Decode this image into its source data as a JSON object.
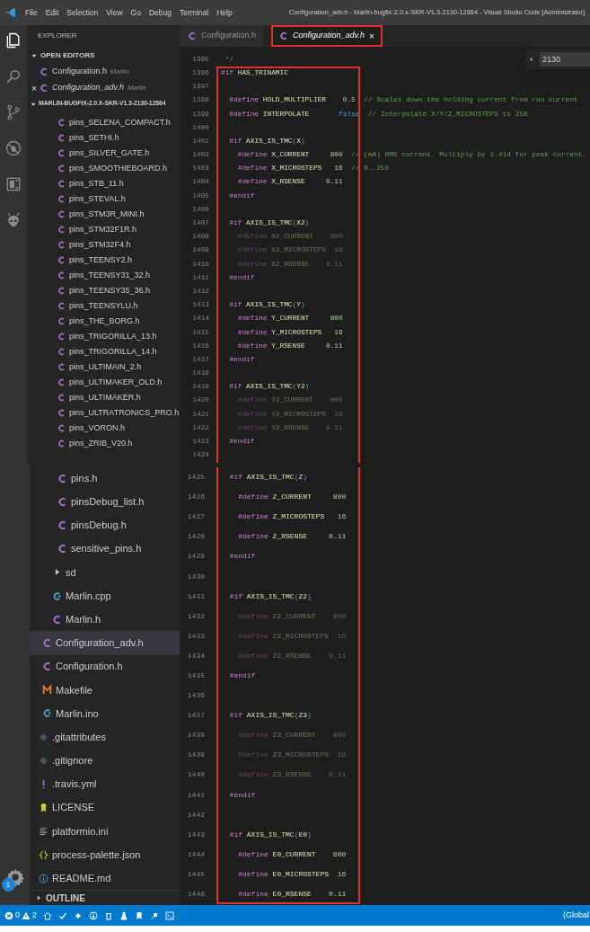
{
  "title_bar": {
    "menu": [
      "File",
      "Edit",
      "Selection",
      "View",
      "Go",
      "Debug",
      "Terminal",
      "Help"
    ],
    "title": "Configuration_adv.h - Marlin-bugfix-2.0.x-SKR-V1.3-2130-12864 - Visual Studio Code [Administrator]"
  },
  "activity_bar": {
    "items": [
      {
        "kind": "files",
        "selected": true
      },
      {
        "kind": "search",
        "selected": false
      },
      {
        "kind": "scm",
        "selected": false
      },
      {
        "kind": "debug",
        "selected": false
      },
      {
        "kind": "extensions",
        "selected": false
      },
      {
        "kind": "alien",
        "selected": false
      }
    ],
    "settings_badge": "1"
  },
  "sidebar": {
    "header": "EXPLORER",
    "open_editors": {
      "label": "OPEN EDITORS",
      "expanded": true,
      "items": [
        {
          "name": "Configuration.h",
          "folder": "Marlin",
          "kind": "c",
          "preview": false
        },
        {
          "name": "Configuration_adv.h",
          "folder": "Marlin",
          "kind": "c",
          "preview": true,
          "close": "×"
        }
      ]
    },
    "project": {
      "label": "MARLIN-BUGFIX-2.0.X-SKR-V1.3-2130-12864",
      "expanded": true
    },
    "top_files": [
      {
        "name": "pins_SELENA_COMPACT.h",
        "kind": "c",
        "selected": false
      },
      {
        "name": "pins_SETHI.h",
        "kind": "c",
        "selected": false
      },
      {
        "name": "pins_SILVER_GATE.h",
        "kind": "c",
        "selected": false
      },
      {
        "name": "pins_SMOOTHIEBOARD.h",
        "kind": "c",
        "selected": false
      },
      {
        "name": "pins_STB_11.h",
        "kind": "c",
        "selected": false
      },
      {
        "name": "pins_STEVAL.h",
        "kind": "c",
        "selected": false
      },
      {
        "name": "pins_STM3R_MINI.h",
        "kind": "c",
        "selected": false
      },
      {
        "name": "pins_STM32F1R.h",
        "kind": "c",
        "selected": false
      },
      {
        "name": "pins_STM32F4.h",
        "kind": "c",
        "selected": false
      },
      {
        "name": "pins_TEENSY2.h",
        "kind": "c",
        "selected": false
      },
      {
        "name": "pins_TEENSY31_32.h",
        "kind": "c",
        "selected": false
      },
      {
        "name": "pins_TEENSY35_36.h",
        "kind": "c",
        "selected": false
      },
      {
        "name": "pins_TEENSYLU.h",
        "kind": "c",
        "selected": false
      },
      {
        "name": "pins_THE_BORG.h",
        "kind": "c",
        "selected": false
      },
      {
        "name": "pins_TRIGORILLA_13.h",
        "kind": "c",
        "selected": false
      },
      {
        "name": "pins_TRIGORILLA_14.h",
        "kind": "c",
        "selected": false
      },
      {
        "name": "pins_ULTIMAIN_2.h",
        "kind": "c",
        "selected": false
      },
      {
        "name": "pins_ULTIMAKER_OLD.h",
        "kind": "c",
        "selected": false
      },
      {
        "name": "pins_ULTIMAKER.h",
        "kind": "c",
        "selected": false
      },
      {
        "name": "pins_ULTRATRONICS_PRO.h",
        "kind": "c",
        "selected": false
      },
      {
        "name": "pins_VORON.h",
        "kind": "c",
        "selected": false
      },
      {
        "name": "pins_ZRIB_V20.h",
        "kind": "c",
        "selected": false
      }
    ],
    "bottom_files": {
      "pins_level": [
        {
          "name": "pins.h",
          "kind": "c",
          "selected": false
        },
        {
          "name": "pinsDebug_list.h",
          "kind": "c",
          "selected": false
        },
        {
          "name": "pinsDebug.h",
          "kind": "c",
          "selected": false
        },
        {
          "name": "sensitive_pins.h",
          "kind": "c",
          "selected": false
        }
      ],
      "src_level": [
        {
          "name": "sd",
          "kind": "folder",
          "expanded": false,
          "selected": false
        },
        {
          "name": "Marlin.cpp",
          "kind": "cpp",
          "selected": false
        },
        {
          "name": "Marlin.h",
          "kind": "c",
          "selected": false
        }
      ],
      "marlin_level": [
        {
          "name": "Configuration_adv.h",
          "kind": "c",
          "selected": true
        },
        {
          "name": "Configuration.h",
          "kind": "c",
          "selected": false
        },
        {
          "name": "Makefile",
          "kind": "make",
          "selected": false
        },
        {
          "name": "Marlin.ino",
          "kind": "ino",
          "selected": false
        }
      ],
      "root_level": [
        {
          "name": ".gitattributes",
          "kind": "git",
          "selected": false
        },
        {
          "name": ".gitignore",
          "kind": "git",
          "selected": false
        },
        {
          "name": ".travis.yml",
          "kind": "yaml",
          "selected": false
        },
        {
          "name": "LICENSE",
          "kind": "license",
          "selected": false
        },
        {
          "name": "platformio.ini",
          "kind": "ini",
          "selected": false
        },
        {
          "name": "process-palette.json",
          "kind": "json",
          "selected": false
        },
        {
          "name": "README.md",
          "kind": "readme",
          "selected": false
        }
      ]
    },
    "outline": {
      "label": "OUTLINE",
      "expanded": false
    }
  },
  "tabs": [
    {
      "label": "Configuration.h",
      "kind": "c",
      "selected": false,
      "preview": false,
      "highlighted": false
    },
    {
      "label": "Configuration_adv.h",
      "kind": "c",
      "selected": true,
      "preview": true,
      "highlighted": true,
      "close": "×"
    }
  ],
  "find_widget": {
    "value": "2130"
  },
  "editor_top": {
    "lines": [
      {
        "n": "1395",
        "inactive": false,
        "tokens": [
          {
            "kind": "comment",
            "text": " */"
          }
        ]
      }
    ],
    "frame": {
      "closed_top": true,
      "closed_bottom": false,
      "lines": [
        {
          "n": "1396",
          "inactive": false,
          "tokens": [
            {
              "kind": "keyword",
              "text": "#if"
            },
            {
              "kind": "name",
              "text": " HAS_TRINAMIC"
            }
          ]
        },
        {
          "n": "1397"
        },
        {
          "n": "1398",
          "inactive": false,
          "tokens": [
            {
              "kind": "keyword",
              "text": "  #define"
            },
            {
              "kind": "name",
              "text": " HOLD_MULTIPLIER"
            },
            {
              "kind": "number",
              "text": "    0.5"
            },
            {
              "kind": "comment",
              "text": "  // Scales down the holding current from run current"
            }
          ]
        },
        {
          "n": "1399",
          "inactive": false,
          "tokens": [
            {
              "kind": "keyword",
              "text": "  #define"
            },
            {
              "kind": "name",
              "text": " INTERPOLATE"
            },
            {
              "kind": "bool",
              "text": "       false"
            },
            {
              "kind": "comment",
              "text": "  // Interpolate X/Y/Z_MICROSTEPS to 256"
            }
          ]
        },
        {
          "n": "1400"
        },
        {
          "n": "1401",
          "inactive": false,
          "tokens": [
            {
              "kind": "keyword",
              "text": "  #if"
            },
            {
              "kind": "name",
              "text": " AXIS_IS_TMC"
            },
            {
              "kind": "paren",
              "text": "("
            },
            {
              "kind": "name",
              "text": "X"
            },
            {
              "kind": "paren",
              "text": ")"
            }
          ]
        },
        {
          "n": "1402",
          "inactive": false,
          "tokens": [
            {
              "kind": "keyword",
              "text": "    #define"
            },
            {
              "kind": "name",
              "text": " X_CURRENT"
            },
            {
              "kind": "number",
              "text": "     800"
            },
            {
              "kind": "comment",
              "text": "  // (mA) RMS current. Multiply by 1.414 for peak current."
            }
          ]
        },
        {
          "n": "1403",
          "inactive": false,
          "tokens": [
            {
              "kind": "keyword",
              "text": "    #define"
            },
            {
              "kind": "name",
              "text": " X_MICROSTEPS"
            },
            {
              "kind": "number",
              "text": "   16"
            },
            {
              "kind": "comment",
              "text": "  // 0..256"
            }
          ]
        },
        {
          "n": "1404",
          "inactive": false,
          "tokens": [
            {
              "kind": "keyword",
              "text": "    #define"
            },
            {
              "kind": "name",
              "text": " X_RSENSE"
            },
            {
              "kind": "number",
              "text": "     0.11"
            }
          ]
        },
        {
          "n": "1405",
          "inactive": false,
          "tokens": [
            {
              "kind": "keyword",
              "text": "  #endif"
            }
          ]
        },
        {
          "n": "1406"
        },
        {
          "n": "1407",
          "inactive": false,
          "tokens": [
            {
              "kind": "keyword",
              "text": "  #if"
            },
            {
              "kind": "name",
              "text": " AXIS_IS_TMC"
            },
            {
              "kind": "paren",
              "text": "("
            },
            {
              "kind": "name",
              "text": "X2"
            },
            {
              "kind": "paren",
              "text": ")"
            }
          ]
        },
        {
          "n": "1408",
          "inactive": true,
          "tokens": [
            {
              "kind": "keyword",
              "text": "    #define"
            },
            {
              "kind": "name",
              "text": " X2_CURRENT"
            },
            {
              "kind": "number",
              "text": "    800"
            }
          ]
        },
        {
          "n": "1409",
          "inactive": true,
          "tokens": [
            {
              "kind": "keyword",
              "text": "    #define"
            },
            {
              "kind": "name",
              "text": " X2_MICROSTEPS"
            },
            {
              "kind": "number",
              "text": "  16"
            }
          ]
        },
        {
          "n": "1410",
          "inactive": true,
          "tokens": [
            {
              "kind": "keyword",
              "text": "    #define"
            },
            {
              "kind": "name",
              "text": " X2_RSENSE"
            },
            {
              "kind": "number",
              "text": "    0.11"
            }
          ]
        },
        {
          "n": "1411",
          "inactive": false,
          "tokens": [
            {
              "kind": "keyword",
              "text": "  #endif"
            }
          ]
        },
        {
          "n": "1412"
        },
        {
          "n": "1413",
          "inactive": false,
          "tokens": [
            {
              "kind": "keyword",
              "text": "  #if"
            },
            {
              "kind": "name",
              "text": " AXIS_IS_TMC"
            },
            {
              "kind": "paren",
              "text": "("
            },
            {
              "kind": "name",
              "text": "Y"
            },
            {
              "kind": "paren",
              "text": ")"
            }
          ]
        },
        {
          "n": "1414",
          "inactive": false,
          "tokens": [
            {
              "kind": "keyword",
              "text": "    #define"
            },
            {
              "kind": "name",
              "text": " Y_CURRENT"
            },
            {
              "kind": "number",
              "text": "     800"
            }
          ]
        },
        {
          "n": "1415",
          "inactive": false,
          "tokens": [
            {
              "kind": "keyword",
              "text": "    #define"
            },
            {
              "kind": "name",
              "text": " Y_MICROSTEPS"
            },
            {
              "kind": "number",
              "text": "   16"
            }
          ]
        },
        {
          "n": "1416",
          "inactive": false,
          "tokens": [
            {
              "kind": "keyword",
              "text": "    #define"
            },
            {
              "kind": "name",
              "text": " Y_RSENSE"
            },
            {
              "kind": "number",
              "text": "     0.11"
            }
          ]
        },
        {
          "n": "1417",
          "inactive": false,
          "tokens": [
            {
              "kind": "keyword",
              "text": "  #endif"
            }
          ]
        },
        {
          "n": "1418"
        },
        {
          "n": "1419",
          "inactive": false,
          "tokens": [
            {
              "kind": "keyword",
              "text": "  #if"
            },
            {
              "kind": "name",
              "text": " AXIS_IS_TMC"
            },
            {
              "kind": "paren",
              "text": "("
            },
            {
              "kind": "name",
              "text": "Y2"
            },
            {
              "kind": "paren",
              "text": ")"
            }
          ]
        },
        {
          "n": "1420",
          "inactive": true,
          "tokens": [
            {
              "kind": "keyword",
              "text": "    #define"
            },
            {
              "kind": "name",
              "text": " Y2_CURRENT"
            },
            {
              "kind": "number",
              "text": "    800"
            }
          ]
        },
        {
          "n": "1421",
          "inactive": true,
          "tokens": [
            {
              "kind": "keyword",
              "text": "    #define"
            },
            {
              "kind": "name",
              "text": " Y2_MICROSTEPS"
            },
            {
              "kind": "number",
              "text": "  16"
            }
          ]
        },
        {
          "n": "1422",
          "inactive": true,
          "tokens": [
            {
              "kind": "keyword",
              "text": "    #define"
            },
            {
              "kind": "name",
              "text": " Y2_RSENSE"
            },
            {
              "kind": "number",
              "text": "    0.11"
            }
          ]
        },
        {
          "n": "1423",
          "inactive": false,
          "tokens": [
            {
              "kind": "keyword",
              "text": "  #endif"
            }
          ]
        },
        {
          "n": "1424"
        }
      ]
    }
  },
  "editor_bottom": {
    "frame": {
      "closed_top": false,
      "closed_bottom": true,
      "lines": [
        {
          "n": "1425",
          "inactive": false,
          "tokens": [
            {
              "kind": "keyword",
              "text": "  #if"
            },
            {
              "kind": "name",
              "text": " AXIS_IS_TMC"
            },
            {
              "kind": "paren",
              "text": "("
            },
            {
              "kind": "name",
              "text": "Z"
            },
            {
              "kind": "paren",
              "text": ")"
            }
          ]
        },
        {
          "n": "1426",
          "inactive": false,
          "tokens": [
            {
              "kind": "keyword",
              "text": "    #define"
            },
            {
              "kind": "name",
              "text": " Z_CURRENT"
            },
            {
              "kind": "number",
              "text": "     800"
            }
          ]
        },
        {
          "n": "1427",
          "inactive": false,
          "tokens": [
            {
              "kind": "keyword",
              "text": "    #define"
            },
            {
              "kind": "name",
              "text": " Z_MICROSTEPS"
            },
            {
              "kind": "number",
              "text": "   16"
            }
          ]
        },
        {
          "n": "1428",
          "inactive": false,
          "tokens": [
            {
              "kind": "keyword",
              "text": "    #define"
            },
            {
              "kind": "name",
              "text": " Z_RSENSE"
            },
            {
              "kind": "number",
              "text": "     0.11"
            }
          ]
        },
        {
          "n": "1429",
          "inactive": false,
          "tokens": [
            {
              "kind": "keyword",
              "text": "  #endif"
            }
          ]
        },
        {
          "n": "1430"
        },
        {
          "n": "1431",
          "inactive": false,
          "tokens": [
            {
              "kind": "keyword",
              "text": "  #if"
            },
            {
              "kind": "name",
              "text": " AXIS_IS_TMC"
            },
            {
              "kind": "paren",
              "text": "("
            },
            {
              "kind": "name",
              "text": "Z2"
            },
            {
              "kind": "paren",
              "text": ")"
            }
          ]
        },
        {
          "n": "1432",
          "inactive": true,
          "tokens": [
            {
              "kind": "keyword",
              "text": "    #define"
            },
            {
              "kind": "name",
              "text": " Z2_CURRENT"
            },
            {
              "kind": "number",
              "text": "    800"
            }
          ]
        },
        {
          "n": "1433",
          "inactive": true,
          "tokens": [
            {
              "kind": "keyword",
              "text": "    #define"
            },
            {
              "kind": "name",
              "text": " Z2_MICROSTEPS"
            },
            {
              "kind": "number",
              "text": "  16"
            }
          ]
        },
        {
          "n": "1434",
          "inactive": true,
          "tokens": [
            {
              "kind": "keyword",
              "text": "    #define"
            },
            {
              "kind": "name",
              "text": " Z2_RSENSE"
            },
            {
              "kind": "number",
              "text": "    0.11"
            }
          ]
        },
        {
          "n": "1435",
          "inactive": false,
          "tokens": [
            {
              "kind": "keyword",
              "text": "  #endif"
            }
          ]
        },
        {
          "n": "1436"
        },
        {
          "n": "1437",
          "inactive": false,
          "tokens": [
            {
              "kind": "keyword",
              "text": "  #if"
            },
            {
              "kind": "name",
              "text": " AXIS_IS_TMC"
            },
            {
              "kind": "paren",
              "text": "("
            },
            {
              "kind": "name",
              "text": "Z3"
            },
            {
              "kind": "paren",
              "text": ")"
            }
          ]
        },
        {
          "n": "1438",
          "inactive": true,
          "tokens": [
            {
              "kind": "keyword",
              "text": "    #define"
            },
            {
              "kind": "name",
              "text": " Z3_CURRENT"
            },
            {
              "kind": "number",
              "text": "    800"
            }
          ]
        },
        {
          "n": "1439",
          "inactive": true,
          "tokens": [
            {
              "kind": "keyword",
              "text": "    #define"
            },
            {
              "kind": "name",
              "text": " Z3_MICROSTEPS"
            },
            {
              "kind": "number",
              "text": "  16"
            }
          ]
        },
        {
          "n": "1440",
          "inactive": true,
          "tokens": [
            {
              "kind": "keyword",
              "text": "    #define"
            },
            {
              "kind": "name",
              "text": " Z3_RSENSE"
            },
            {
              "kind": "number",
              "text": "    0.11"
            }
          ]
        },
        {
          "n": "1441",
          "inactive": false,
          "tokens": [
            {
              "kind": "keyword",
              "text": "  #endif"
            }
          ]
        },
        {
          "n": "1442"
        },
        {
          "n": "1443",
          "inactive": false,
          "tokens": [
            {
              "kind": "keyword",
              "text": "  #if"
            },
            {
              "kind": "name",
              "text": " AXIS_IS_TMC"
            },
            {
              "kind": "paren",
              "text": "("
            },
            {
              "kind": "name",
              "text": "E0"
            },
            {
              "kind": "paren",
              "text": ")"
            }
          ]
        },
        {
          "n": "1444",
          "inactive": false,
          "tokens": [
            {
              "kind": "keyword",
              "text": "    #define"
            },
            {
              "kind": "name",
              "text": " E0_CURRENT"
            },
            {
              "kind": "number",
              "text": "    800"
            }
          ]
        },
        {
          "n": "1445",
          "inactive": false,
          "tokens": [
            {
              "kind": "keyword",
              "text": "    #define"
            },
            {
              "kind": "name",
              "text": " E0_MICROSTEPS"
            },
            {
              "kind": "number",
              "text": "  16"
            }
          ]
        },
        {
          "n": "1446",
          "inactive": false,
          "tokens": [
            {
              "kind": "keyword",
              "text": "    #define"
            },
            {
              "kind": "name",
              "text": " E0_RSENSE"
            },
            {
              "kind": "number",
              "text": "    0.11"
            }
          ]
        }
      ]
    }
  },
  "status_bar": {
    "errors": "0",
    "warnings": "2",
    "right": "(Global"
  }
}
